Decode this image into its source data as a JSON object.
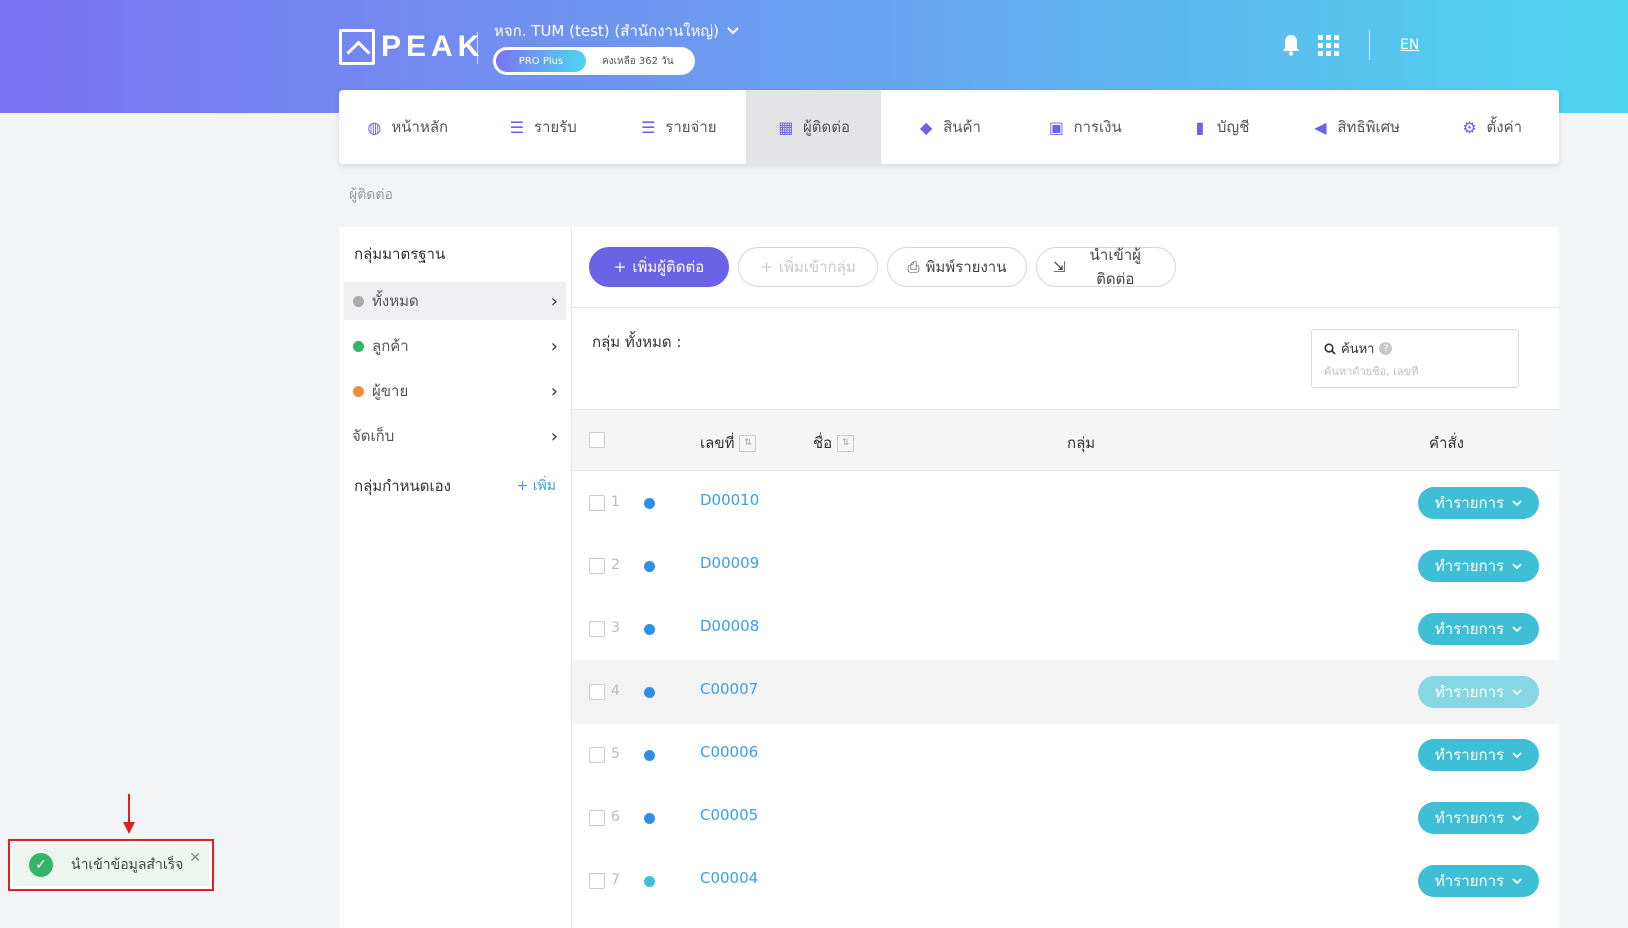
{
  "header": {
    "logo_text": "PEAK",
    "company": "หจก. TUM (test) (สำนักงานใหญ่)",
    "plan": "PRO Plus",
    "days_left": "คงเหลือ 362 วัน",
    "lang": "EN"
  },
  "nav": {
    "items": [
      {
        "label": "หน้าหลัก",
        "icon": "chart-icon"
      },
      {
        "label": "รายรับ",
        "icon": "list-icon"
      },
      {
        "label": "รายจ่าย",
        "icon": "list-icon"
      },
      {
        "label": "ผู้ติดต่อ",
        "icon": "contacts-icon"
      },
      {
        "label": "สินค้า",
        "icon": "box-icon"
      },
      {
        "label": "การเงิน",
        "icon": "money-icon"
      },
      {
        "label": "บัญชี",
        "icon": "book-icon"
      },
      {
        "label": "สิทธิพิเศษ",
        "icon": "megaphone-icon"
      },
      {
        "label": "ตั้งค่า",
        "icon": "gear-icon"
      }
    ],
    "active_index": 3
  },
  "breadcrumb": "ผู้ติดต่อ",
  "sidebar": {
    "standard_heading": "กลุ่มมาตรฐาน",
    "items": [
      {
        "label": "ทั้งหมด",
        "color": "#aaaaaa"
      },
      {
        "label": "ลูกค้า",
        "color": "#34b56b"
      },
      {
        "label": "ผู้ขาย",
        "color": "#f28c38"
      },
      {
        "label": "จัดเก็บ",
        "color": ""
      }
    ],
    "custom_heading": "กลุ่มกำหนดเอง",
    "add_label": "+ เพิ่ม"
  },
  "toolbar": {
    "add_contact": "เพิ่มผู้ติดต่อ",
    "add_to_group": "เพิ่มเข้ากลุ่ม",
    "print_report": "พิมพ์รายงาน",
    "import_contacts": "นำเข้าผู้ติดต่อ"
  },
  "group_label": "กลุ่ม ทั้งหมด :",
  "search": {
    "label": "ค้นหา",
    "placeholder": "ค้นหาด้วยชื่อ, เลขที่"
  },
  "table": {
    "headers": {
      "code": "เลขที่",
      "name": "ชื่อ",
      "group": "กลุ่ม",
      "action": "คำสั่ง"
    },
    "action_label": "ทำรายการ",
    "rows": [
      {
        "num": "1",
        "code": "D00010",
        "dot": "#2f8fe8"
      },
      {
        "num": "2",
        "code": "D00009",
        "dot": "#2f8fe8"
      },
      {
        "num": "3",
        "code": "D00008",
        "dot": "#2f8fe8"
      },
      {
        "num": "4",
        "code": "C00007",
        "dot": "#2f8fe8"
      },
      {
        "num": "5",
        "code": "C00006",
        "dot": "#2f8fe8"
      },
      {
        "num": "6",
        "code": "C00005",
        "dot": "#2f8fe8"
      },
      {
        "num": "7",
        "code": "C00004",
        "dot": "#3fbfd6"
      }
    ]
  },
  "toast": {
    "message": "นำเข้าข้อมูลสำเร็จ"
  }
}
